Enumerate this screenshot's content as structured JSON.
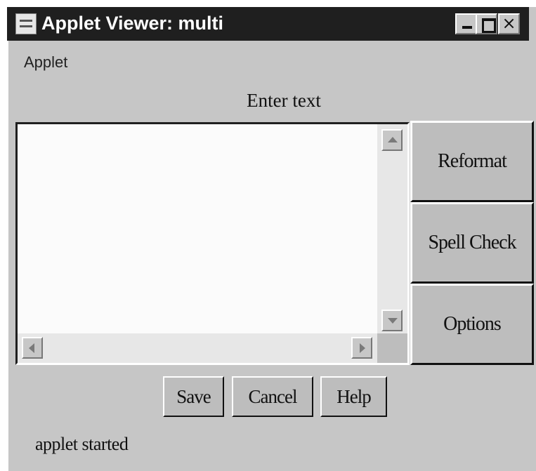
{
  "window": {
    "title": "Applet Viewer: multi"
  },
  "menu": {
    "items": [
      "Applet"
    ]
  },
  "form": {
    "heading": "Enter text",
    "text_value": ""
  },
  "side_buttons": [
    "Reformat",
    "Spell Check",
    "Options"
  ],
  "bottom_buttons": [
    "Save",
    "Cancel",
    "Help"
  ],
  "status": {
    "text": "applet started"
  },
  "icons": {
    "app": "applet-icon",
    "minimize": "minimize-icon",
    "maximize": "maximize-icon",
    "close": "close-icon"
  },
  "colors": {
    "window_background": "#c6c6c6",
    "titlebar": "#1f1f1f",
    "text_area": "#fbfbfb",
    "button_face": "#bdbdbd"
  }
}
